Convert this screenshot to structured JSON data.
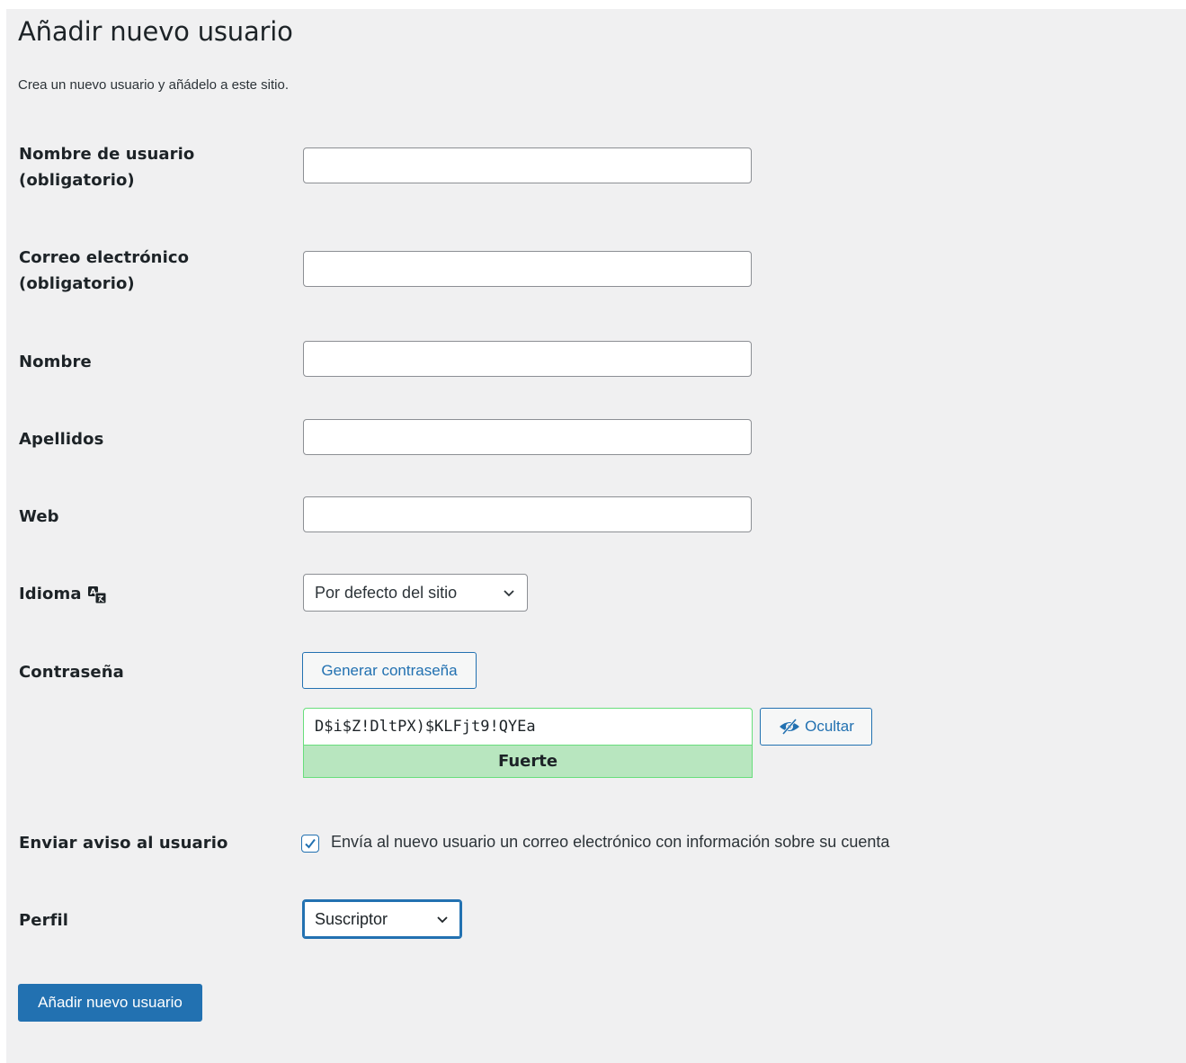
{
  "page": {
    "title": "Añadir nuevo usuario",
    "subtitle": "Crea un nuevo usuario y añádelo a este sitio."
  },
  "form": {
    "username": {
      "label_line1": "Nombre de usuario",
      "label_line2": "(obligatorio)",
      "value": ""
    },
    "email": {
      "label_line1": "Correo electrónico",
      "label_line2": "(obligatorio)",
      "value": ""
    },
    "first_name": {
      "label": "Nombre",
      "value": ""
    },
    "last_name": {
      "label": "Apellidos",
      "value": ""
    },
    "website": {
      "label": "Web",
      "value": ""
    },
    "language": {
      "label": "Idioma",
      "icon": "translation-icon",
      "selected": "Por defecto del sitio"
    },
    "password": {
      "label": "Contraseña",
      "generate_label": "Generar contraseña",
      "value": "D$i$Z!DltPX)$KLFjt9!QYEa",
      "hide_label": "Ocultar",
      "hide_icon": "eye-slash-icon",
      "strength": "Fuerte",
      "strength_color": "#b8e6bf"
    },
    "send_notification": {
      "label": "Enviar aviso al usuario",
      "checkbox_label": "Envía al nuevo usuario un correo electrónico con información sobre su cuenta",
      "checked": true
    },
    "role": {
      "label": "Perfil",
      "selected": "Suscriptor"
    },
    "submit_label": "Añadir nuevo usuario"
  },
  "colors": {
    "accent": "#2271b1",
    "background": "#f0f0f1",
    "strength_border": "#68de7c"
  }
}
